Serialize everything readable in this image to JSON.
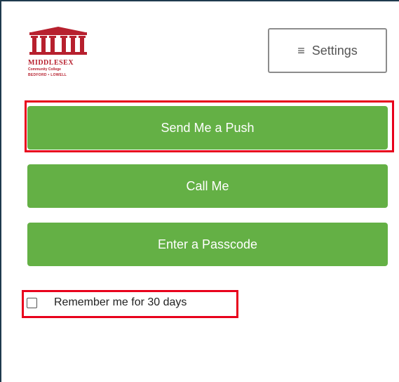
{
  "logo": {
    "name": "MIDDLESEX",
    "line2": "Community College",
    "line3": "BEDFORD • LOWELL",
    "color": "#b7202e"
  },
  "settings": {
    "icon": "menu-icon",
    "icon_glyph": "≡",
    "label": "Settings"
  },
  "actions": {
    "push_label": "Send Me a Push",
    "call_label": "Call Me",
    "passcode_label": "Enter a Passcode",
    "button_color": "#64b045"
  },
  "remember": {
    "label": "Remember me for 30 days",
    "checked": false
  },
  "highlight_color": "#e8001c"
}
